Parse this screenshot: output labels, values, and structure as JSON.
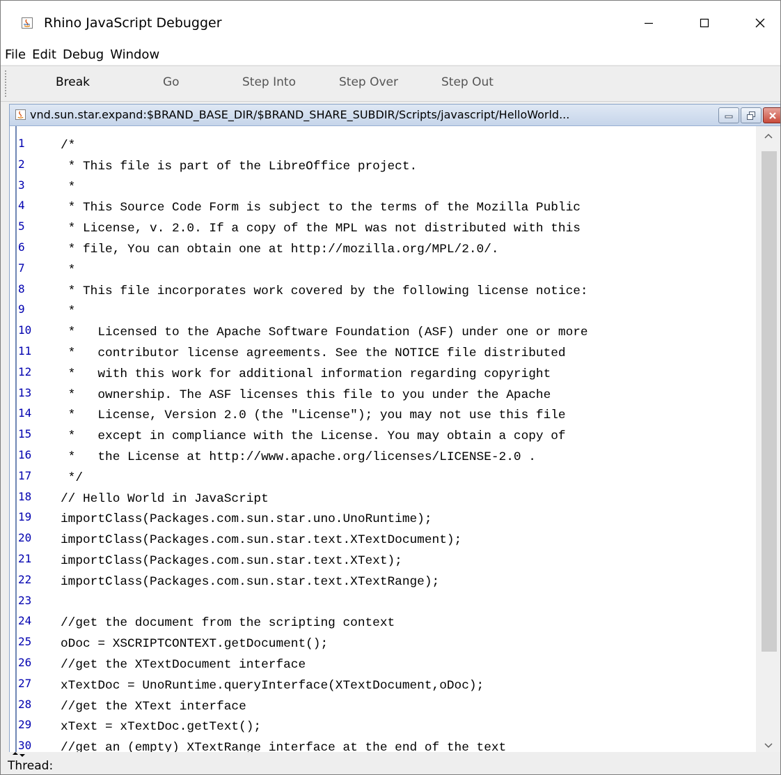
{
  "window": {
    "title": "Rhino JavaScript Debugger"
  },
  "menu": {
    "items": [
      "File",
      "Edit",
      "Debug",
      "Window"
    ]
  },
  "toolbar": {
    "buttons": [
      {
        "label": "Break",
        "enabled": true
      },
      {
        "label": "Go",
        "enabled": false
      },
      {
        "label": "Step Into",
        "enabled": false
      },
      {
        "label": "Step Over",
        "enabled": false
      },
      {
        "label": "Step Out",
        "enabled": false
      }
    ]
  },
  "editor": {
    "title": "vnd.sun.star.expand:$BRAND_BASE_DIR/$BRAND_SHARE_SUBDIR/Scripts/javascript/HelloWorld...",
    "lines": [
      {
        "num": "1",
        "text": "/*"
      },
      {
        "num": "2",
        "text": " * This file is part of the LibreOffice project."
      },
      {
        "num": "3",
        "text": " *"
      },
      {
        "num": "4",
        "text": " * This Source Code Form is subject to the terms of the Mozilla Public"
      },
      {
        "num": "5",
        "text": " * License, v. 2.0. If a copy of the MPL was not distributed with this"
      },
      {
        "num": "6",
        "text": " * file, You can obtain one at http://mozilla.org/MPL/2.0/."
      },
      {
        "num": "7",
        "text": " *"
      },
      {
        "num": "8",
        "text": " * This file incorporates work covered by the following license notice:"
      },
      {
        "num": "9",
        "text": " *"
      },
      {
        "num": "10",
        "text": " *   Licensed to the Apache Software Foundation (ASF) under one or more"
      },
      {
        "num": "11",
        "text": " *   contributor license agreements. See the NOTICE file distributed"
      },
      {
        "num": "12",
        "text": " *   with this work for additional information regarding copyright"
      },
      {
        "num": "13",
        "text": " *   ownership. The ASF licenses this file to you under the Apache"
      },
      {
        "num": "14",
        "text": " *   License, Version 2.0 (the \"License\"); you may not use this file"
      },
      {
        "num": "15",
        "text": " *   except in compliance with the License. You may obtain a copy of"
      },
      {
        "num": "16",
        "text": " *   the License at http://www.apache.org/licenses/LICENSE-2.0 ."
      },
      {
        "num": "17",
        "text": " */"
      },
      {
        "num": "18",
        "text": "// Hello World in JavaScript"
      },
      {
        "num": "19",
        "text": "importClass(Packages.com.sun.star.uno.UnoRuntime);"
      },
      {
        "num": "20",
        "text": "importClass(Packages.com.sun.star.text.XTextDocument);"
      },
      {
        "num": "21",
        "text": "importClass(Packages.com.sun.star.text.XText);"
      },
      {
        "num": "22",
        "text": "importClass(Packages.com.sun.star.text.XTextRange);"
      },
      {
        "num": "23",
        "text": ""
      },
      {
        "num": "24",
        "text": "//get the document from the scripting context"
      },
      {
        "num": "25",
        "text": "oDoc = XSCRIPTCONTEXT.getDocument();"
      },
      {
        "num": "26",
        "text": "//get the XTextDocument interface"
      },
      {
        "num": "27",
        "text": "xTextDoc = UnoRuntime.queryInterface(XTextDocument,oDoc);"
      },
      {
        "num": "28",
        "text": "//get the XText interface"
      },
      {
        "num": "29",
        "text": "xText = xTextDoc.getText();"
      },
      {
        "num": "30",
        "text": "//get an (empty) XTextRange interface at the end of the text"
      }
    ]
  },
  "status": {
    "thread_label": "Thread:"
  }
}
